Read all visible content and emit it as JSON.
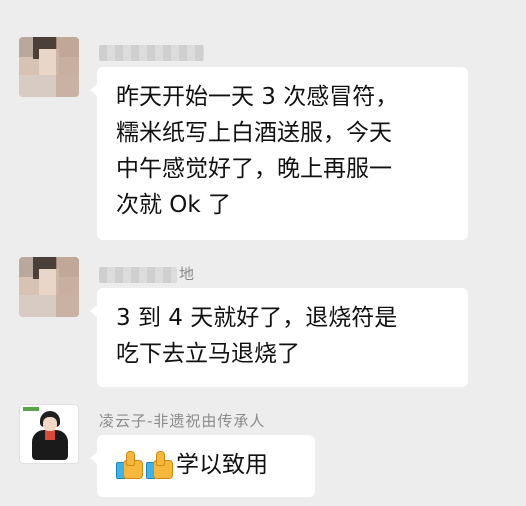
{
  "messages": [
    {
      "sender_name_visible": "",
      "lines": [
        "昨天开始一天 3 次感冒符，",
        "糯米纸写上白酒送服，今天",
        "中午感觉好了，晚上再服一",
        "次就 Ok 了"
      ]
    },
    {
      "sender_name_visible": "地",
      "lines": [
        "3 到 4 天就好了，退烧符是",
        "吃下去立马退烧了"
      ]
    },
    {
      "sender_name_visible": "凌云子-非遗祝由传承人",
      "text": "学以致用",
      "emoji": [
        "thumbs-up-icon",
        "thumbs-up-icon"
      ]
    }
  ]
}
